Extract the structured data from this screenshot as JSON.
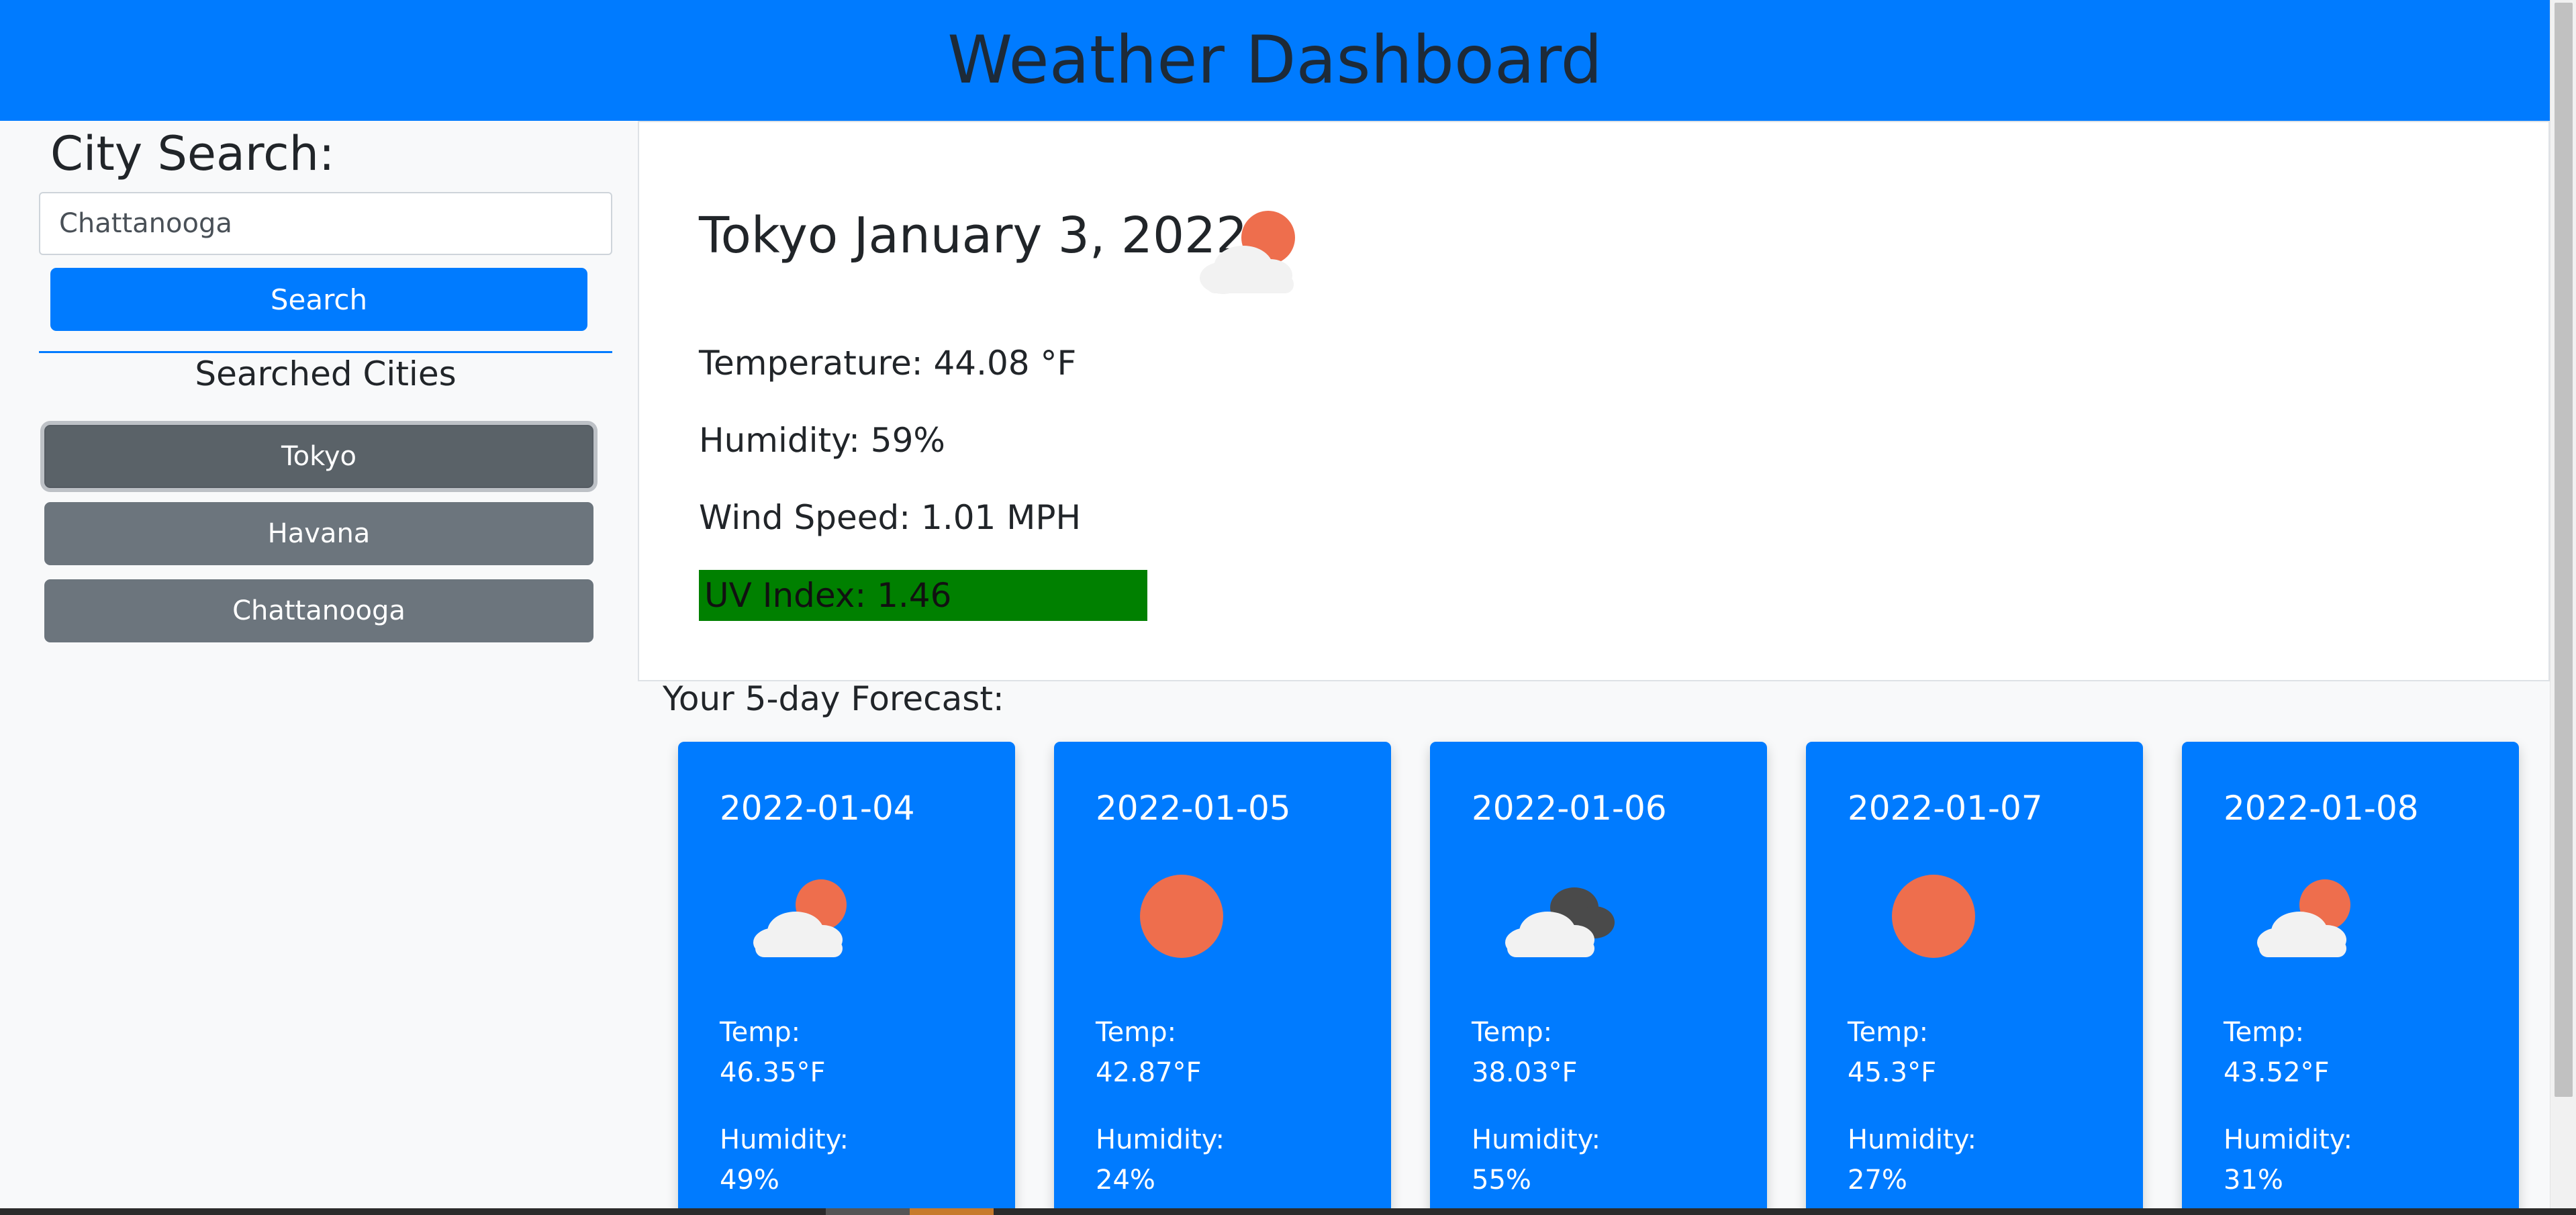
{
  "header": {
    "title": "Weather Dashboard"
  },
  "sidebar": {
    "search_label": "City Search:",
    "search_value": "Chattanooga",
    "search_button": "Search",
    "searched_title": "Searched Cities",
    "cities": [
      {
        "label": "Tokyo",
        "active": true
      },
      {
        "label": "Havana",
        "active": false
      },
      {
        "label": "Chattanooga",
        "active": false
      }
    ]
  },
  "current": {
    "title": "Tokyo January 3, 2022",
    "icon": "partly-cloudy-day-icon",
    "temperature": "Temperature: 44.08 °F",
    "humidity": "Humidity: 59%",
    "wind": "Wind Speed: 1.01 MPH",
    "uv": "UV Index: 1.46",
    "uv_color": "#008000"
  },
  "forecast": {
    "title": "Your 5-day Forecast:",
    "temp_label": "Temp:",
    "humidity_label": "Humidity:",
    "days": [
      {
        "date": "2022-01-04",
        "icon": "partly-cloudy-day-icon",
        "temp": "46.35°F",
        "humidity": "49%"
      },
      {
        "date": "2022-01-05",
        "icon": "sun-icon",
        "temp": "42.87°F",
        "humidity": "24%"
      },
      {
        "date": "2022-01-06",
        "icon": "broken-clouds-icon",
        "temp": "38.03°F",
        "humidity": "55%"
      },
      {
        "date": "2022-01-07",
        "icon": "sun-icon",
        "temp": "45.3°F",
        "humidity": "27%"
      },
      {
        "date": "2022-01-08",
        "icon": "partly-cloudy-day-icon",
        "temp": "43.52°F",
        "humidity": "31%"
      }
    ]
  },
  "colors": {
    "brand": "#007bff",
    "sun": "#ee6e4d",
    "cloud": "#f2f2f2",
    "dark_cloud": "#4a4a4a"
  }
}
